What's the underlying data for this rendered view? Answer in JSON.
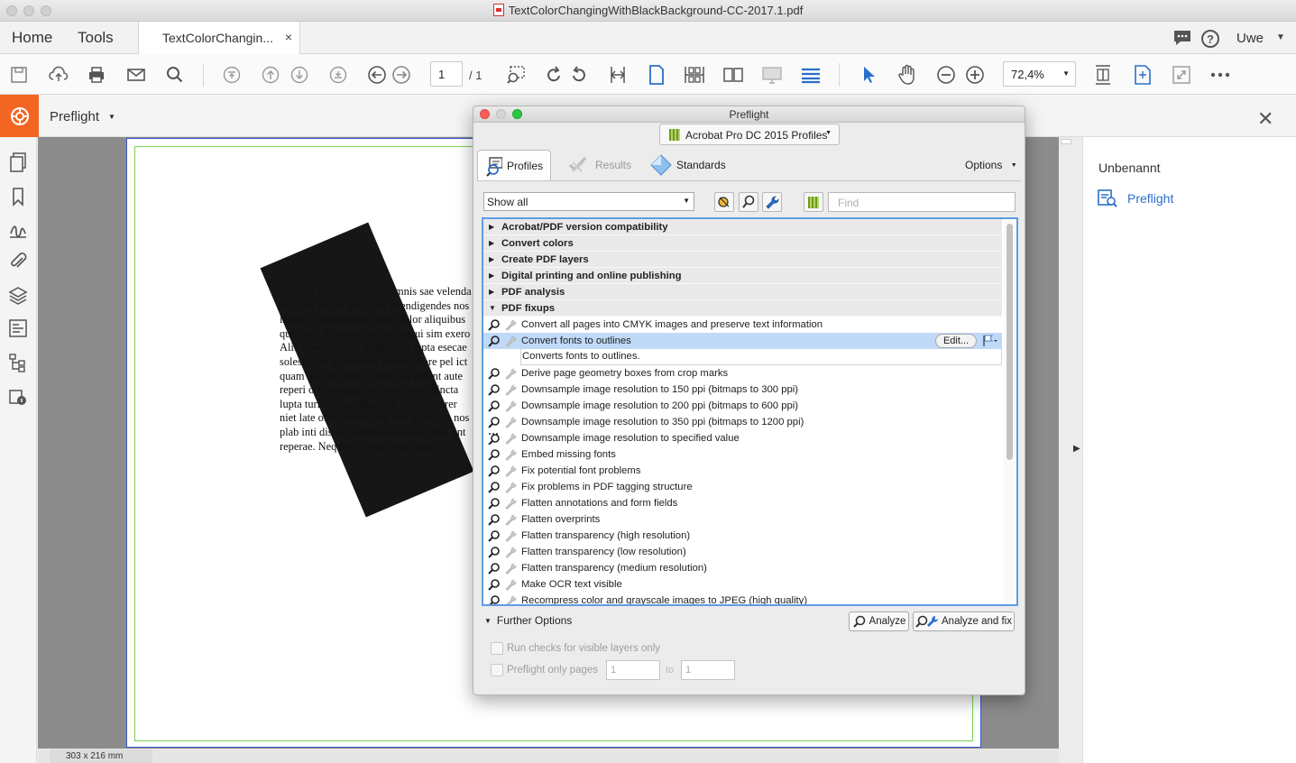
{
  "window": {
    "title": "TextColorChangingWithBlackBackground-CC-2017.1.pdf"
  },
  "tabs": {
    "home": "Home",
    "tools": "Tools",
    "document": "TextColorChangin...",
    "close": "×"
  },
  "user": {
    "name": "Uwe"
  },
  "toolbar": {
    "page_current": "1",
    "page_total": "/ 1",
    "zoom": "72,4%"
  },
  "tool": {
    "name": "Preflight"
  },
  "document": {
    "text_lines": [
      "Os ento eratiae. Damus, omnis sae velenda",
      "sequunt eaquo tem quae evendigendes nos",
      "liatate et laceaquam aliqui solor aliquibus",
      "que etur? Totatio et re, as esequi sim exero",
      "Alit, consendi sed magnatum repta esecae",
      "solest fugit es eictotae volent abore pel ict",
      "quam que aut quis et enet qui dolent aute",
      "reperi offictemquis excesed eossimincta",
      "lupta turistemque iduntem hariati aturer",
      "niet late offici aborepedi essi quam, sa nos",
      "plab inti dis aut labora comnis et ressi unt",
      "reperae. Nequae ex etur as aut aut."
    ],
    "dimensions": "303 x 216 mm"
  },
  "right_panel": {
    "title": "Unbenannt",
    "item": "Preflight"
  },
  "preflight": {
    "title": "Preflight",
    "profile_set": "Acrobat Pro DC 2015 Profiles",
    "tabs": [
      "Profiles",
      "Results",
      "Standards"
    ],
    "options": "Options",
    "filter": "Show all",
    "find_placeholder": "Find",
    "groups": [
      "Acrobat/PDF version compatibility",
      "Convert colors",
      "Create PDF layers",
      "Digital printing and online publishing",
      "PDF analysis",
      "PDF fixups"
    ],
    "items": [
      "Convert all pages into CMYK images and preserve text information",
      "Convert fonts to outlines",
      "Derive page geometry boxes from crop marks",
      "Downsample image resolution to 150 ppi (bitmaps to 300 ppi)",
      "Downsample image resolution to 200 ppi (bitmaps to 600 ppi)",
      "Downsample image resolution to 350 ppi (bitmaps to 1200 ppi)",
      "Downsample image resolution to specified value",
      "Embed missing fonts",
      "Fix potential font problems",
      "Fix problems in PDF tagging structure",
      "Flatten annotations and form fields",
      "Flatten overprints",
      "Flatten transparency (high resolution)",
      "Flatten transparency (low resolution)",
      "Flatten transparency (medium resolution)",
      "Make OCR text visible",
      "Recompress color and grayscale images to JPEG (high quality)"
    ],
    "selected_description": "Converts fonts to outlines.",
    "edit": "Edit...",
    "further_options": "Further Options",
    "analyze": "Analyze",
    "analyze_fix": "Analyze and fix",
    "run_visible_layers": "Run checks for visible layers only",
    "preflight_pages": "Preflight only pages",
    "page_from": "1",
    "page_to_label": "to",
    "page_to": "1"
  },
  "colors": {
    "accent": "#f26522",
    "selection": "#bfd9f7",
    "link": "#2a6fcc",
    "focus": "#5d9ce6"
  }
}
